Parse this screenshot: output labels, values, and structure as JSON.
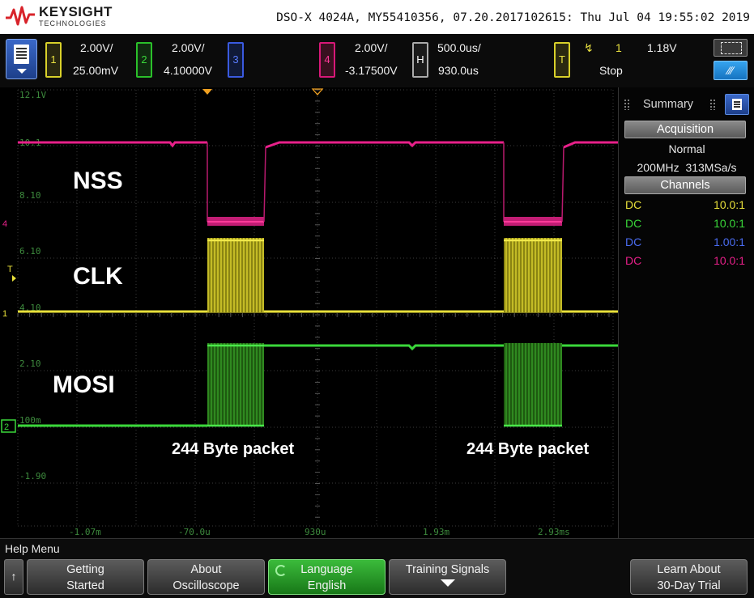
{
  "header": {
    "brand": "KEYSIGHT",
    "brand_sub": "TECHNOLOGIES",
    "device_info": "DSO-X 4024A, MY55410356, 07.20.2017102615: Thu Jul 04 19:55:02 2019"
  },
  "channels": [
    {
      "num": "1",
      "scale": "2.00V/",
      "offset": "25.00mV",
      "color": "#e8e03a"
    },
    {
      "num": "2",
      "scale": "2.00V/",
      "offset": "4.10000V",
      "color": "#3ad83a"
    },
    {
      "num": "3",
      "scale": "",
      "offset": "",
      "color": "#4a6cf0"
    },
    {
      "num": "4",
      "scale": "2.00V/",
      "offset": "-3.17500V",
      "color": "#e8208a"
    }
  ],
  "horizontal": {
    "label": "H",
    "scale": "500.0us/",
    "delay": "930.0us"
  },
  "trigger": {
    "label": "T",
    "edge": "↯",
    "source": "1",
    "level": "1.18V",
    "status": "Stop"
  },
  "quick_buttons": {
    "auto_scale": "∕∕∕"
  },
  "grid": {
    "y_labels": [
      "12.1V",
      "10.1",
      "8.10",
      "6.10",
      "4.10",
      "2.10",
      "100m",
      "-1.90"
    ],
    "x_labels": [
      "-1.07m",
      "-70.0u",
      "930u",
      "1.93m",
      "2.93ms"
    ],
    "markers": {
      "ch4": "4",
      "ch1": "1",
      "ch2": "2",
      "trig": "T"
    }
  },
  "signal_labels": {
    "nss": "NSS",
    "clk": "CLK",
    "mosi": "MOSI"
  },
  "packet_labels": [
    "244 Byte packet",
    "244 Byte packet"
  ],
  "side_panel": {
    "title": "Summary",
    "acquisition_header": "Acquisition",
    "mode": "Normal",
    "bandwidth": "200MHz",
    "sample_rate": "313MSa/s",
    "channels_header": "Channels",
    "channel_rows": [
      {
        "coupling": "DC",
        "probe": "10.0:1",
        "color": "#e8e03a"
      },
      {
        "coupling": "DC",
        "probe": "10.0:1",
        "color": "#3ad83a"
      },
      {
        "coupling": "DC",
        "probe": "1.00:1",
        "color": "#4a6cf0"
      },
      {
        "coupling": "DC",
        "probe": "10.0:1",
        "color": "#e8208a"
      }
    ]
  },
  "bottom_menu": {
    "title": "Help Menu",
    "back_icon": "↑",
    "softkeys": [
      {
        "line1": "Getting",
        "line2": "Started"
      },
      {
        "line1": "About",
        "line2": "Oscilloscope"
      },
      {
        "line1": "Language",
        "line2": "English"
      },
      {
        "line1": "Training Signals",
        "line2": ""
      },
      {
        "line1": "Learn About",
        "line2": "30-Day Trial"
      }
    ]
  }
}
